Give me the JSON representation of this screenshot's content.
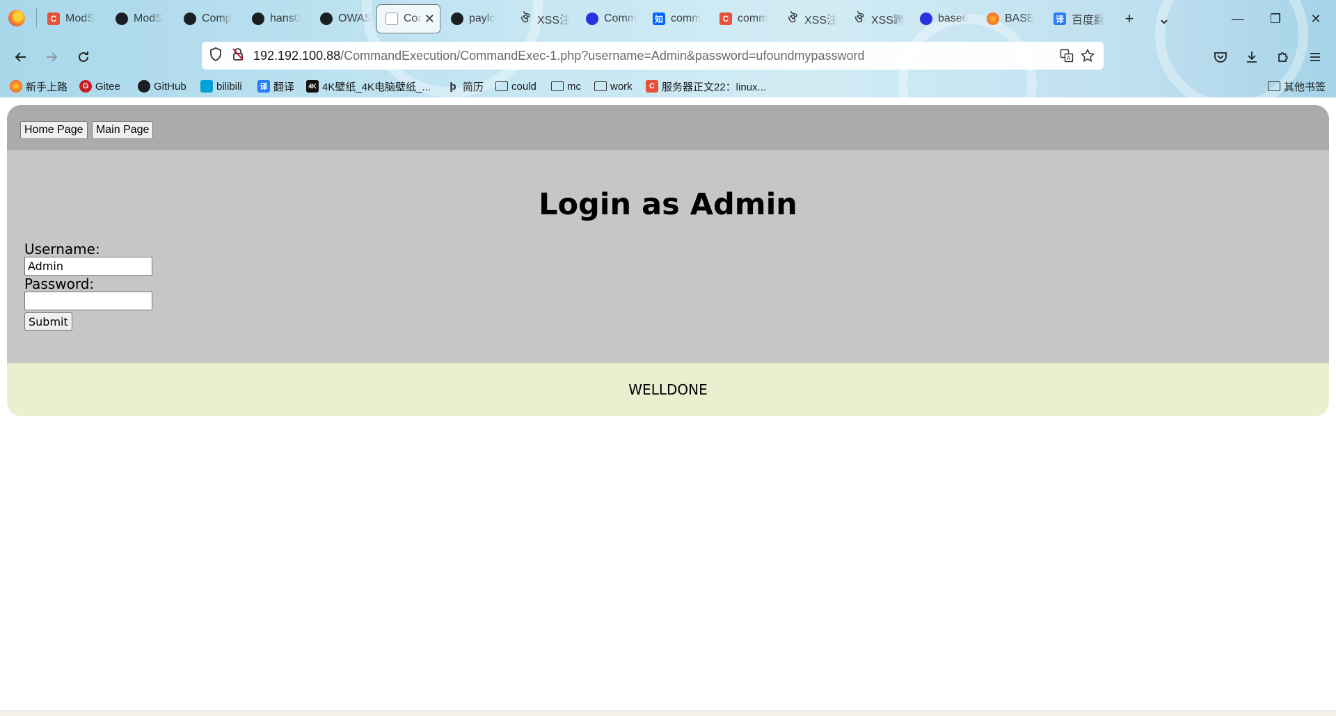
{
  "browser": {
    "tabs": [
      {
        "label": "ModS",
        "icon": "csdn-icon"
      },
      {
        "label": "ModS",
        "icon": "github-icon"
      },
      {
        "label": "Comp",
        "icon": "github-icon"
      },
      {
        "label": "hans0",
        "icon": "github-icon"
      },
      {
        "label": "OWAS",
        "icon": "github-icon"
      },
      {
        "label": "Cor",
        "icon": "dvwa-icon",
        "active": true
      },
      {
        "label": "paylo",
        "icon": "github-icon"
      },
      {
        "label": "XSS注",
        "icon": "butterfly-icon"
      },
      {
        "label": "Comm",
        "icon": "baidu-icon"
      },
      {
        "label": "comm",
        "icon": "zhihu-icon"
      },
      {
        "label": "comm",
        "icon": "csdn-icon"
      },
      {
        "label": "XSS注",
        "icon": "butterfly-icon"
      },
      {
        "label": "XSS跨",
        "icon": "butterfly-icon"
      },
      {
        "label": "base6",
        "icon": "baidu-icon"
      },
      {
        "label": "BASE",
        "icon": "swirl-icon"
      },
      {
        "label": "百度翻",
        "icon": "fanyi-icon"
      }
    ],
    "new_tab_symbol": "+",
    "tab_list_symbol": "⌄",
    "window_controls": {
      "minimize": "—",
      "restore": "❐",
      "close": "✕"
    },
    "url": {
      "host": "192.192.100.88",
      "path": "/CommandExecution/CommandExec-1.php?username=Admin&password=ufoundmypassword"
    },
    "bookmarks": [
      {
        "label": "新手上路",
        "icon": "firefox-icon"
      },
      {
        "label": "Gitee",
        "icon": "gitee-icon"
      },
      {
        "label": "GitHub",
        "icon": "github-icon"
      },
      {
        "label": "bilibili",
        "icon": "bilibili-icon"
      },
      {
        "label": "翻译",
        "icon": "fanyi-icon"
      },
      {
        "label": "4K壁纸_4K电脑壁纸_...",
        "icon": "4k-icon"
      },
      {
        "label": "简历",
        "icon": "resume-icon"
      },
      {
        "label": "could",
        "icon": "folder-icon"
      },
      {
        "label": "mc",
        "icon": "folder-icon"
      },
      {
        "label": "work",
        "icon": "folder-icon"
      },
      {
        "label": "服务器正文22：linux...",
        "icon": "csdn-icon"
      }
    ],
    "other_bookmarks": "其他书签"
  },
  "page": {
    "nav": {
      "home": "Home Page",
      "main": "Main Page"
    },
    "title": "Login as Admin",
    "form": {
      "username_label": "Username:",
      "username_value": "Admin",
      "password_label": "Password:",
      "password_value": "",
      "submit": "Submit"
    },
    "footer": "WELLDONE"
  },
  "colors": {
    "topnav_bg": "#ababab",
    "main_bg": "#c6c6c6",
    "footer_bg": "#e9f0cf"
  }
}
